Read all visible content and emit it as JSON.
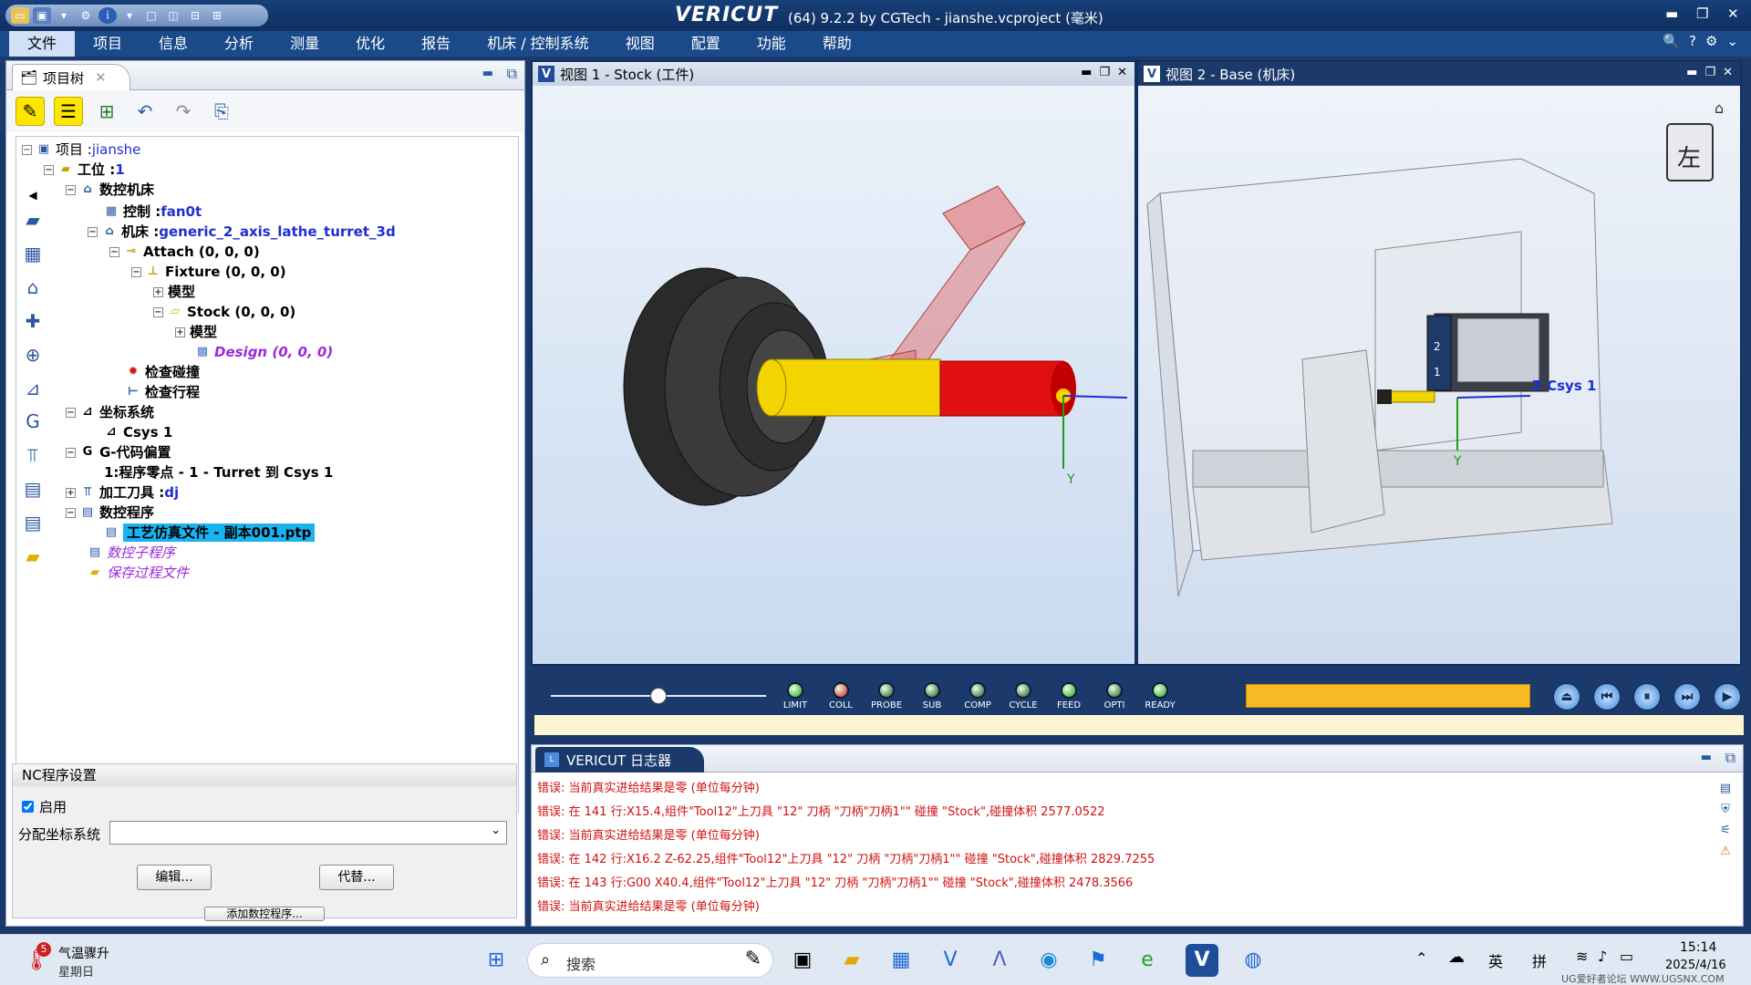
{
  "titlebar": {
    "app_name": "VERICUT",
    "subtitle": "(64)  9.2.2 by CGTech - jianshe.vcproject (毫米)"
  },
  "menu": [
    "文件",
    "项目",
    "信息",
    "分析",
    "测量",
    "优化",
    "报告",
    "机床 / 控制系统",
    "视图",
    "配置",
    "功能",
    "帮助"
  ],
  "project_tree": {
    "tab_label": "项目树",
    "nodes": [
      {
        "label": "项目 : ",
        "value": "jianshe"
      },
      {
        "label": "工位 : ",
        "value": "1"
      },
      {
        "label": "数控机床"
      },
      {
        "label": "控制 : ",
        "value": "fan0t"
      },
      {
        "label": "机床 : ",
        "value": "generic_2_axis_lathe_turret_3d"
      },
      {
        "label": "Attach (0, 0, 0)"
      },
      {
        "label": "Fixture (0, 0, 0)"
      },
      {
        "label": "模型"
      },
      {
        "label": "Stock (0, 0, 0)"
      },
      {
        "label": "模型"
      },
      {
        "label": "Design (0, 0, 0)"
      },
      {
        "label": "检查碰撞"
      },
      {
        "label": "检查行程"
      },
      {
        "label": "坐标系统"
      },
      {
        "label": "Csys 1"
      },
      {
        "label": "G-代码偏置"
      },
      {
        "label": "1:程序零点 - 1 - Turret 到 Csys 1"
      },
      {
        "label": "加工刀具 : ",
        "value": "dj"
      },
      {
        "label": "数控程序"
      },
      {
        "label": "工艺仿真文件 - 副本001.ptp"
      },
      {
        "label": "数控子程序"
      },
      {
        "label": "保存过程文件"
      }
    ]
  },
  "nc_settings": {
    "title": "NC程序设置",
    "enable_label": "启用",
    "enable_checked": true,
    "csys_label": "分配坐标系统",
    "csys_value": "",
    "edit_button": "编辑...",
    "substitute_button": "代替...",
    "add_button": "添加数控程序..."
  },
  "view1": {
    "title": "视图 1 - Stock (工件)",
    "axis_y": "Y"
  },
  "view2": {
    "title": "视图 2 - Base (机床)",
    "orientation": "左",
    "csys_label": "Z Csys 1",
    "axis_y": "Y",
    "turret_numbers": [
      "2",
      "1"
    ]
  },
  "indicators": [
    {
      "label": "LIMIT",
      "color": "#26a51e"
    },
    {
      "label": "COLL",
      "color": "#d01818"
    },
    {
      "label": "PROBE",
      "color": "#1f5a2a"
    },
    {
      "label": "SUB",
      "color": "#1f5a2a"
    },
    {
      "label": "COMP",
      "color": "#1f5a2a"
    },
    {
      "label": "CYCLE",
      "color": "#1f5a2a"
    },
    {
      "label": "FEED",
      "color": "#26a51e"
    },
    {
      "label": "OPTI",
      "color": "#1f5a2a"
    },
    {
      "label": "READY",
      "color": "#26a51e"
    }
  ],
  "playback": {
    "slider_fraction": 0.5,
    "progress_fraction": 1.0
  },
  "logger": {
    "tab_label": "VERICUT 日志器",
    "lines": [
      "错误: 当前真实进给结果是零 (单位每分钟)",
      "错误: 在 141 行:X15.4,组件\"Tool12\"上刀具 \"12\" 刀柄 \"刀柄\"刀柄1\"\" 碰撞 \"Stock\",碰撞体积 2577.0522",
      "错误: 当前真实进给结果是零 (单位每分钟)",
      "错误: 在 142 行:X16.2 Z-62.25,组件\"Tool12\"上刀具 \"12\" 刀柄 \"刀柄\"刀柄1\"\" 碰撞 \"Stock\",碰撞体积 2829.7255",
      "错误: 在 143 行:G00 X40.4,组件\"Tool12\"上刀具 \"12\" 刀柄 \"刀柄\"刀柄1\"\" 碰撞 \"Stock\",碰撞体积 2478.3566",
      "错误: 当前真实进给结果是零 (单位每分钟)"
    ]
  },
  "taskbar": {
    "weather_count": "5",
    "weather_title": "气温骤升",
    "weather_day": "星期日",
    "search_placeholder": "搜索",
    "ime_lang": "英",
    "ime_mode": "拼",
    "time": "15:14",
    "date": "2025/4/16",
    "watermark": "UG爱好者论坛 WWW.UGSNX.COM"
  }
}
